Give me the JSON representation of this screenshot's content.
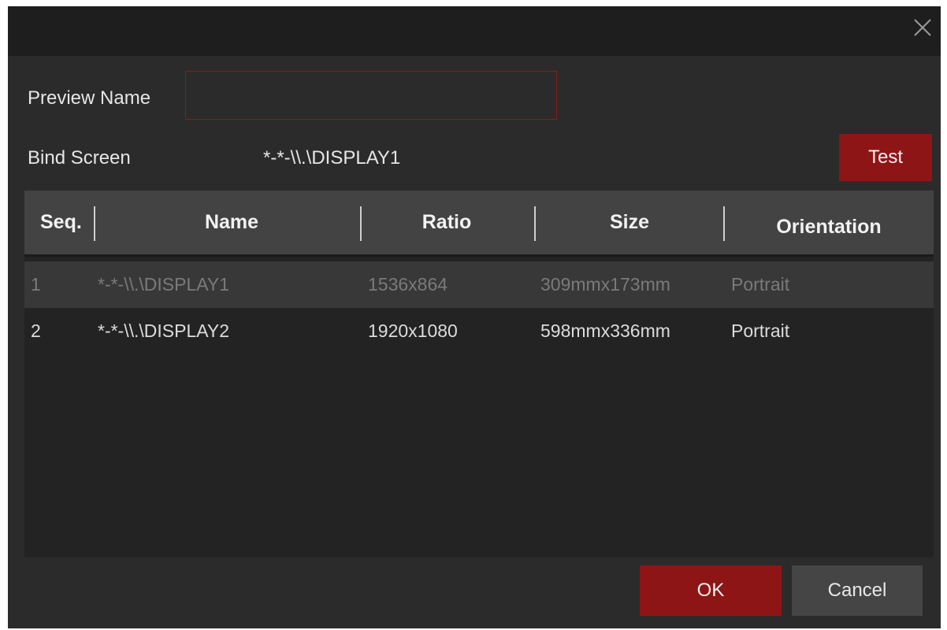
{
  "dialog": {
    "close_icon": "close-icon"
  },
  "form": {
    "preview_name_label": "Preview Name",
    "preview_name_value": "",
    "bind_screen_label": "Bind Screen",
    "bind_screen_value": "*-*-\\\\.\\DISPLAY1",
    "test_label": "Test"
  },
  "table": {
    "headers": [
      "Seq.",
      "Name",
      "Ratio",
      "Size",
      "Orientation"
    ],
    "rows": [
      {
        "seq": "1",
        "name": "*-*-\\\\.\\DISPLAY1",
        "ratio": "1536x864",
        "size": "309mmx173mm",
        "orientation": "Portrait",
        "selected": true
      },
      {
        "seq": "2",
        "name": "*-*-\\\\.\\DISPLAY2",
        "ratio": "1920x1080",
        "size": "598mmx336mm",
        "orientation": "Portrait",
        "selected": false
      }
    ]
  },
  "footer": {
    "ok_label": "OK",
    "cancel_label": "Cancel"
  },
  "colors": {
    "accent": "#8e1515",
    "background": "#2b2b2b",
    "titlebar": "#1e1e1e",
    "header": "#434343"
  }
}
